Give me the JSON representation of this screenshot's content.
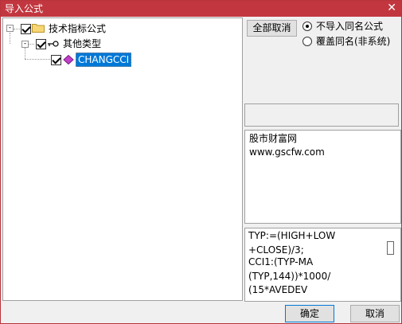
{
  "window": {
    "title": "导入公式",
    "close_glyph": "✕"
  },
  "tree": {
    "root": {
      "label": "技术指标公式",
      "checked": true,
      "expander": "-"
    },
    "child": {
      "label": "其他类型",
      "checked": true,
      "expander": "-"
    },
    "leaf": {
      "label": "CHANGCCI",
      "checked": true,
      "selected": true
    }
  },
  "options": {
    "deselect_all_label": "全部取消",
    "radio_no_import_label": "不导入同名公式",
    "radio_overwrite_label": "覆盖同名(非系统)",
    "selected_radio": "radio_no_import"
  },
  "info": {
    "lines": [
      "股市财富网",
      "www.gscfw.com"
    ]
  },
  "formula": {
    "lines": [
      "TYP:=(HIGH+LOW",
      "+CLOSE)/3;",
      "CCI1:(TYP-MA",
      "(TYP,144))*1000/",
      "(15*AVEDEV"
    ]
  },
  "buttons": {
    "ok_label": "确定",
    "cancel_label": "取消"
  },
  "colors": {
    "titlebar": "#c2373f",
    "selection": "#0078d7",
    "default_button_border": "#0078d7"
  }
}
